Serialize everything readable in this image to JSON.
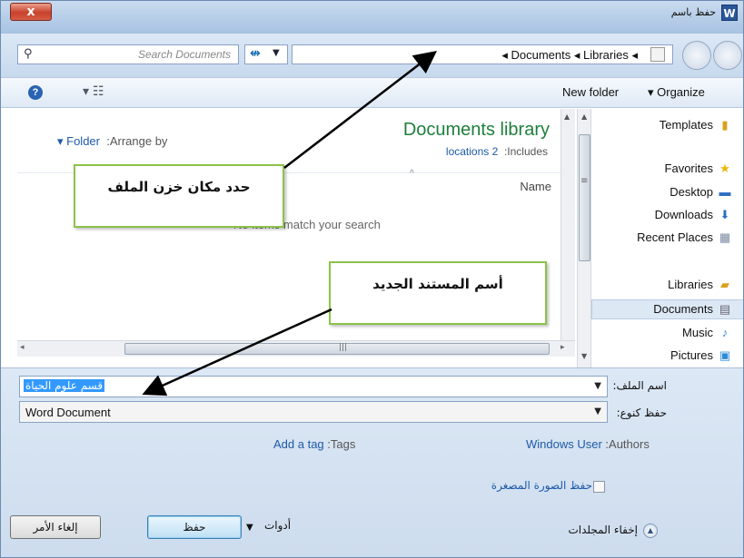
{
  "window": {
    "title": "حفظ باسم",
    "app_icon_letter": "W",
    "close_label": "x"
  },
  "address": {
    "search_placeholder": "Search Documents",
    "breadcrumb": "◂ Documents ◂ Libraries ◂"
  },
  "toolbar": {
    "new_folder": "New folder",
    "organize": "▾ Organize",
    "help": "?"
  },
  "content": {
    "arrange_folder": "▾ Folder",
    "arrange_by": ":Arrange by",
    "library_title": "Documents library",
    "includes_link": "locations 2",
    "includes_label": ":Includes",
    "column_name": "Name",
    "no_match": "No items match your search"
  },
  "nav": {
    "items": [
      {
        "label": "Templates",
        "icon": "folder-icon"
      },
      {
        "label": "Favorites",
        "icon": "star-icon"
      },
      {
        "label": "Desktop",
        "icon": "desktop-icon"
      },
      {
        "label": "Downloads",
        "icon": "downloads-icon"
      },
      {
        "label": "Recent Places",
        "icon": "recent-places-icon"
      },
      {
        "label": "Libraries",
        "icon": "libraries-icon"
      },
      {
        "label": "Documents",
        "icon": "documents-icon"
      },
      {
        "label": "Music",
        "icon": "music-icon"
      },
      {
        "label": "Pictures",
        "icon": "pictures-icon"
      }
    ],
    "selected": "Documents"
  },
  "form": {
    "filename_label": "اسم الملف:",
    "filename_value": "قسم علوم الحياة",
    "filetype_label": "حفظ كنوع:",
    "filetype_value": "Word Document",
    "tags_link": "Add a tag",
    "tags_label": ":Tags",
    "authors_link": "Windows User",
    "authors_label": ":Authors",
    "thumbnail_label": "حفظ الصورة المصغرة",
    "hide_folders": "إخفاء المجلدات",
    "tools": "أدوات",
    "save": "حفظ",
    "cancel": "إلغاء الأمر"
  },
  "callouts": {
    "location": "حدد مكان خزن الملف",
    "new_name": "أسم المستند الجديد"
  },
  "colors": {
    "accent_green": "#1e7f3c",
    "link_blue": "#1e5aa8",
    "callout_border": "#8cc24a",
    "selection": "#3399ff"
  }
}
